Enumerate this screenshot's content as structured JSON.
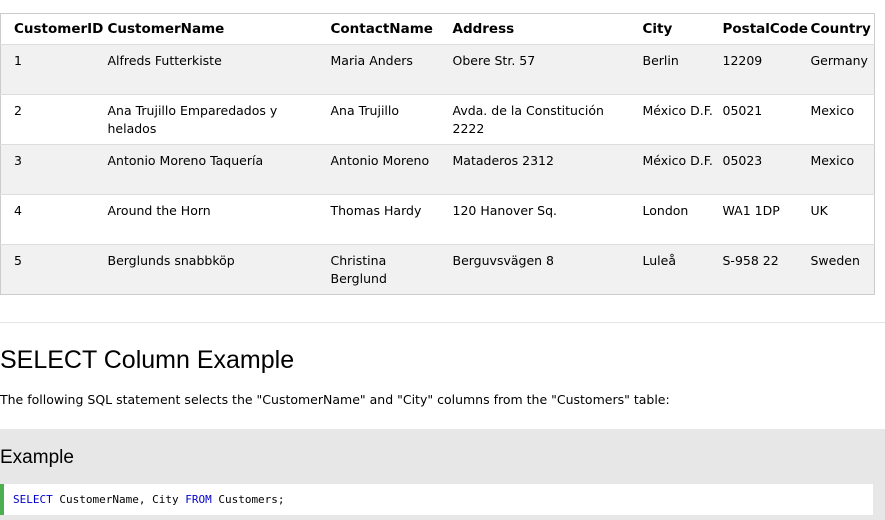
{
  "table": {
    "headers": [
      "CustomerID",
      "CustomerName",
      "ContactName",
      "Address",
      "City",
      "PostalCode",
      "Country"
    ],
    "rows": [
      [
        "1",
        "Alfreds Futterkiste",
        "Maria Anders",
        "Obere Str. 57",
        "Berlin",
        "12209",
        "Germany"
      ],
      [
        "2",
        "Ana Trujillo Emparedados y helados",
        "Ana Trujillo",
        "Avda. de la Constitución 2222",
        "México D.F.",
        "05021",
        "Mexico"
      ],
      [
        "3",
        "Antonio Moreno Taquería",
        "Antonio Moreno",
        "Mataderos 2312",
        "México D.F.",
        "05023",
        "Mexico"
      ],
      [
        "4",
        "Around the Horn",
        "Thomas Hardy",
        "120 Hanover Sq.",
        "London",
        "WA1 1DP",
        "UK"
      ],
      [
        "5",
        "Berglunds snabbköp",
        "Christina Berglund",
        "Berguvsvägen 8",
        "Luleå",
        "S-958 22",
        "Sweden"
      ]
    ]
  },
  "section": {
    "heading": "SELECT Column Example",
    "description": "The following SQL statement selects the \"CustomerName\" and \"City\" columns from the \"Customers\" table:"
  },
  "example": {
    "title": "Example",
    "code": {
      "kw_select": "SELECT",
      "columns": " CustomerName, City ",
      "kw_from": "FROM",
      "table": " Customers;"
    }
  },
  "colors": {
    "code_accent": "#4caf50",
    "keyword": "#0000cd",
    "row_stripe": "#f1f1f1",
    "example_bg": "#e7e7e7"
  }
}
